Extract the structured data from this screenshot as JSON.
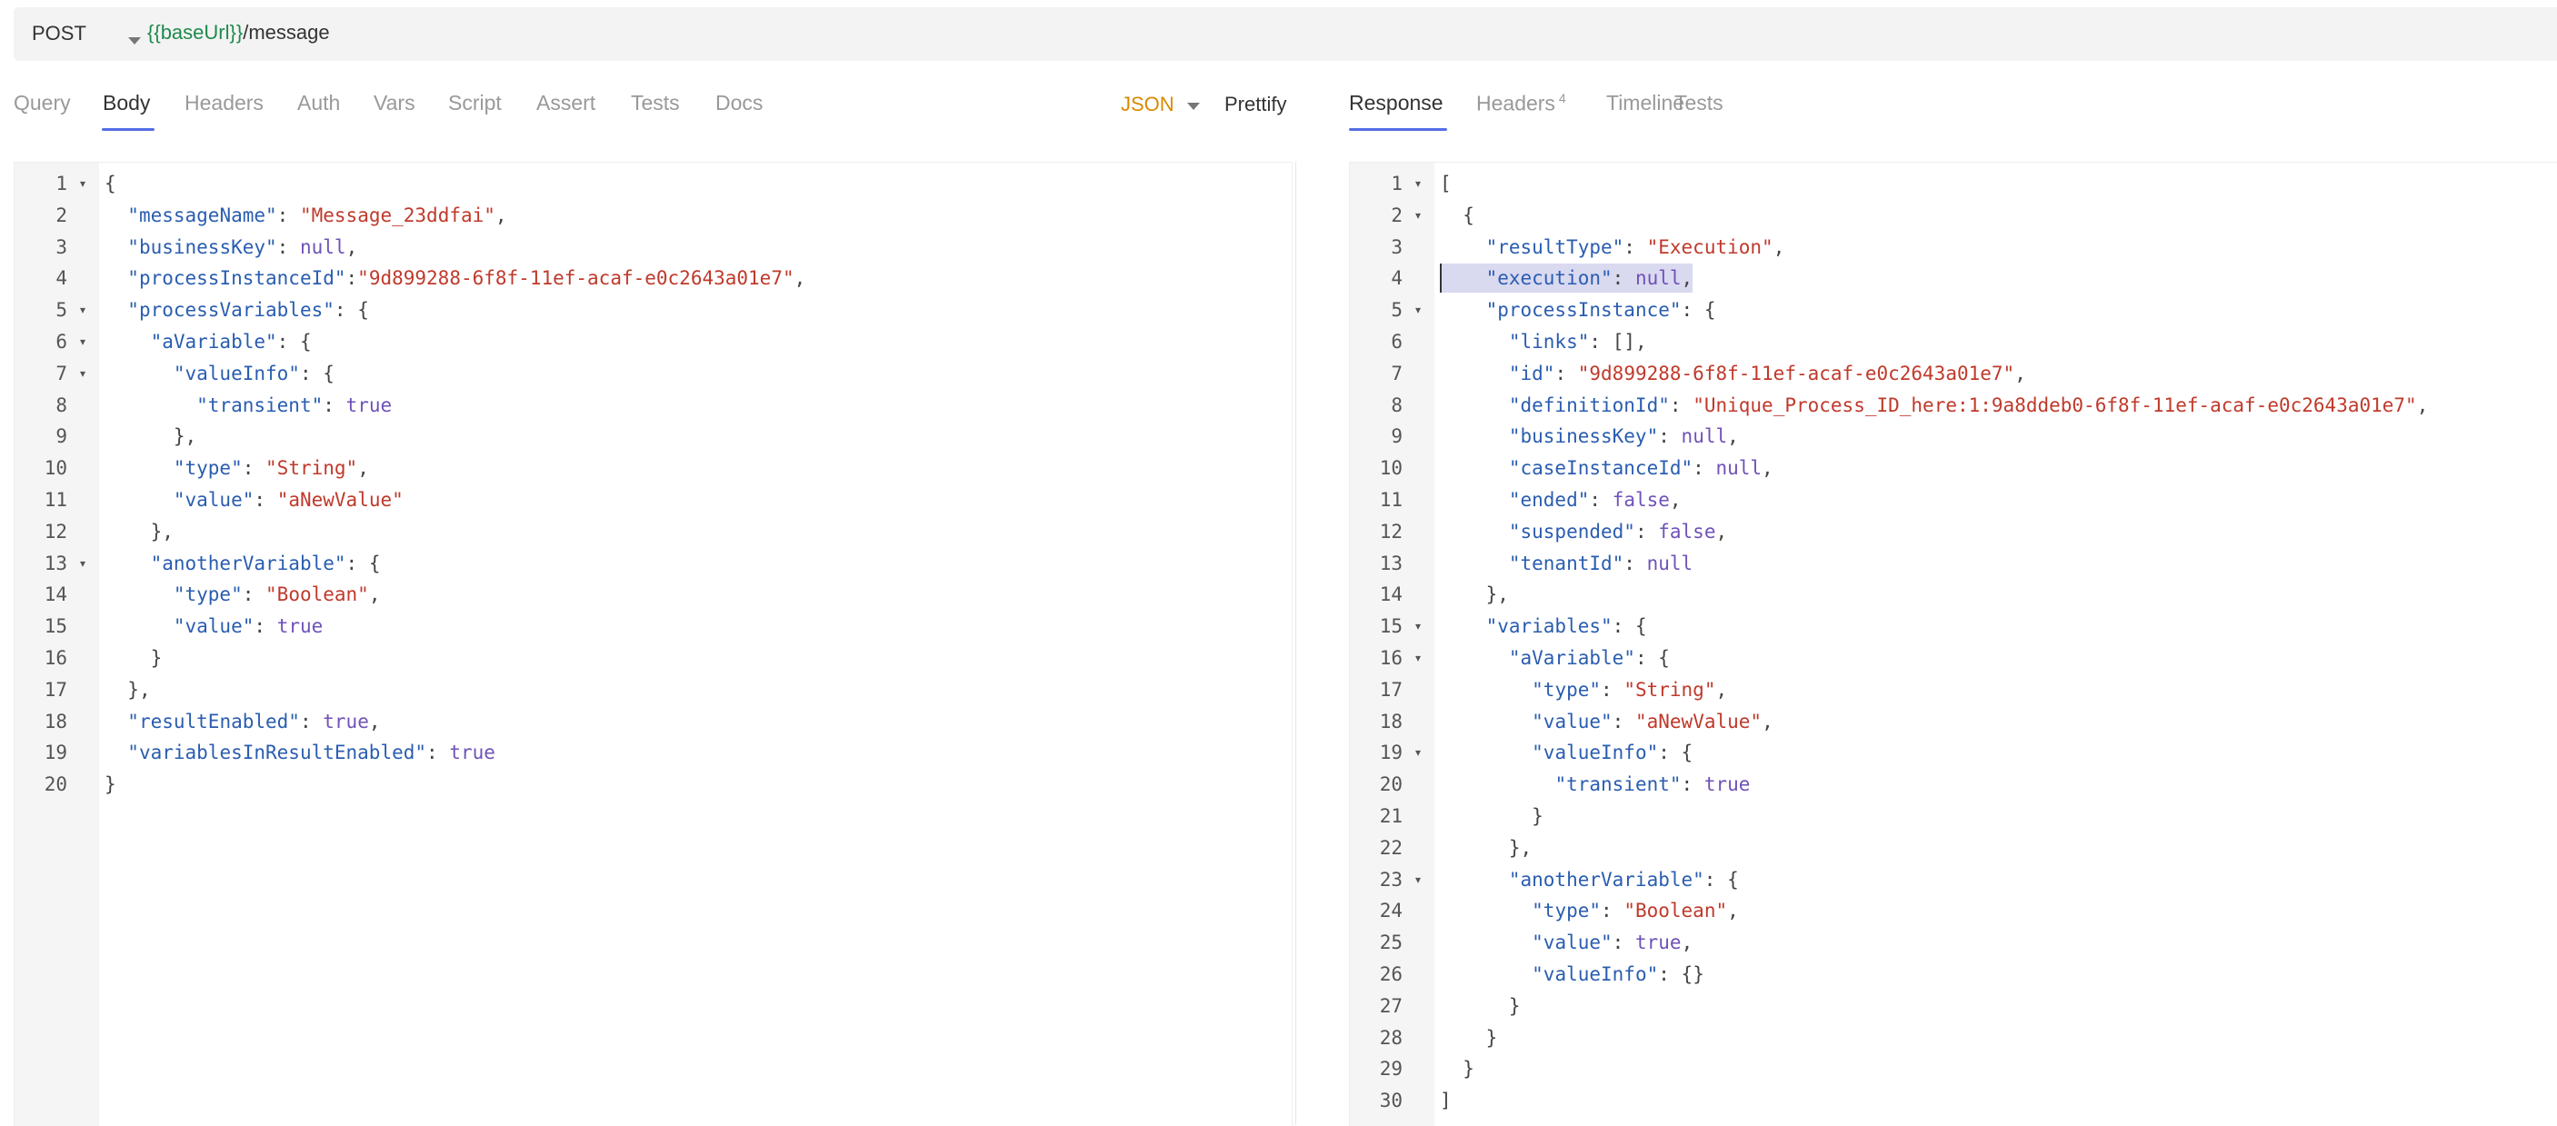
{
  "request": {
    "method": "POST",
    "url_var": "{{baseUrl}}",
    "url_path": "/message"
  },
  "request_tabs": [
    "Query",
    "Body",
    "Headers",
    "Auth",
    "Vars",
    "Script",
    "Assert",
    "Tests",
    "Docs"
  ],
  "active_request_tab": "Body",
  "body_format": "JSON",
  "prettify_label": "Prettify",
  "response_tabs": [
    {
      "label": "Response",
      "badge": ""
    },
    {
      "label": "Headers",
      "badge": "4"
    },
    {
      "label": "Timeline",
      "badge": ""
    },
    {
      "label": "Tests",
      "badge": ""
    }
  ],
  "active_response_tab": "Response",
  "request_body_lines": [
    "{",
    "  \"messageName\": \"Message_23ddfai\",",
    "  \"businessKey\": null,",
    "  \"processInstanceId\":\"9d899288-6f8f-11ef-acaf-e0c2643a01e7\",",
    "  \"processVariables\": {",
    "    \"aVariable\": {",
    "      \"valueInfo\": {",
    "        \"transient\": true",
    "      },",
    "      \"type\": \"String\",",
    "      \"value\": \"aNewValue\"",
    "    },",
    "    \"anotherVariable\": {",
    "      \"type\": \"Boolean\",",
    "      \"value\": true",
    "    }",
    "  },",
    "  \"resultEnabled\": true,",
    "  \"variablesInResultEnabled\": true",
    "}"
  ],
  "request_fold_lines": [
    1,
    5,
    6,
    7,
    13
  ],
  "response_body_lines": [
    "[",
    "  {",
    "    \"resultType\": \"Execution\",",
    "    \"execution\": null,",
    "    \"processInstance\": {",
    "      \"links\": [],",
    "      \"id\": \"9d899288-6f8f-11ef-acaf-e0c2643a01e7\",",
    "      \"definitionId\": \"Unique_Process_ID_here:1:9a8ddeb0-6f8f-11ef-acaf-e0c2643a01e7\",",
    "      \"businessKey\": null,",
    "      \"caseInstanceId\": null,",
    "      \"ended\": false,",
    "      \"suspended\": false,",
    "      \"tenantId\": null",
    "    },",
    "    \"variables\": {",
    "      \"aVariable\": {",
    "        \"type\": \"String\",",
    "        \"value\": \"aNewValue\",",
    "        \"valueInfo\": {",
    "          \"transient\": true",
    "        }",
    "      },",
    "      \"anotherVariable\": {",
    "        \"type\": \"Boolean\",",
    "        \"value\": true,",
    "        \"valueInfo\": {}",
    "      }",
    "    }",
    "  }",
    "]"
  ],
  "response_fold_lines": [
    1,
    2,
    5,
    15,
    16,
    19,
    23
  ],
  "response_highlight_line": 4,
  "colors": {
    "accent": "#546de5",
    "json_key": "#2a5db0",
    "json_string": "#c0392b",
    "json_literal": "#6f52b8",
    "url_variable": "#1f8a4c",
    "format_label": "#d98a00"
  }
}
